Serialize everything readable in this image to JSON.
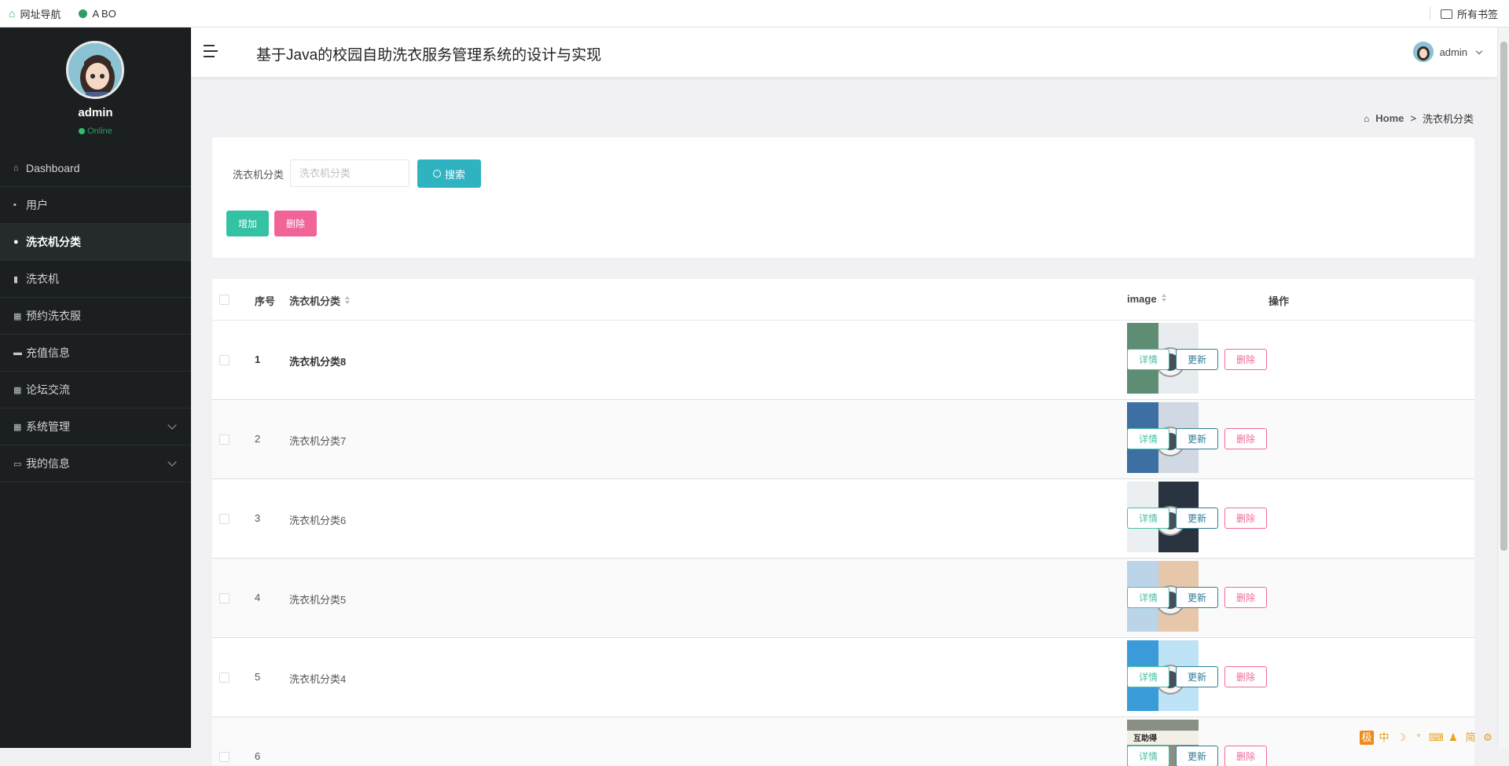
{
  "bookmarks": {
    "items": [
      {
        "icon": "house-icon",
        "label": "网址导航"
      },
      {
        "icon": "leaf-icon",
        "label": "A BO"
      }
    ],
    "all_label": "所有书签"
  },
  "sidebar": {
    "user": {
      "name": "admin",
      "status": "Online"
    },
    "items": [
      {
        "icon": "home-icon",
        "label": "Dashboard"
      },
      {
        "icon": "user-icon",
        "label": "用户"
      },
      {
        "icon": "pin-icon",
        "label": "洗衣机分类",
        "active": true
      },
      {
        "icon": "chart-icon",
        "label": "洗衣机"
      },
      {
        "icon": "grid-icon",
        "label": "预约洗衣服"
      },
      {
        "icon": "lock-icon",
        "label": "充值信息"
      },
      {
        "icon": "grid-icon",
        "label": "论坛交流"
      },
      {
        "icon": "grid-icon",
        "label": "系统管理",
        "expandable": true
      },
      {
        "icon": "card-icon",
        "label": "我的信息",
        "expandable": true
      }
    ]
  },
  "header": {
    "title": "基于Java的校园自助洗衣服务管理系统的设计与实现",
    "user": "admin"
  },
  "breadcrumb": {
    "home": "Home",
    "separator": ">",
    "current": "洗衣机分类"
  },
  "search": {
    "label": "洗衣机分类",
    "placeholder": "洗衣机分类",
    "button": "搜索"
  },
  "actions": {
    "add": "增加",
    "delete": "删除"
  },
  "table": {
    "headers": {
      "index": "序号",
      "category": "洗衣机分类",
      "image": "image",
      "ops": "操作"
    },
    "row_actions": {
      "detail": "详情",
      "update": "更新",
      "delete": "删除"
    },
    "rows": [
      {
        "index": "1",
        "category": "洗衣机分类8",
        "image_colors": [
          "#5f8d74",
          "#e9ecef"
        ]
      },
      {
        "index": "2",
        "category": "洗衣机分类7",
        "image_colors": [
          "#3d6fa3",
          "#cfd8e3"
        ]
      },
      {
        "index": "3",
        "category": "洗衣机分类6",
        "image_colors": [
          "#eceff2",
          "#2a3440"
        ]
      },
      {
        "index": "4",
        "category": "洗衣机分类5",
        "image_colors": [
          "#bcd4e8",
          "#e7c7a9"
        ]
      },
      {
        "index": "5",
        "category": "洗衣机分类4",
        "image_colors": [
          "#3a9bd8",
          "#bfe3f6"
        ]
      },
      {
        "index": "6",
        "category": "",
        "image_colors": [
          "#8a8f86",
          "#f2efe6"
        ]
      }
    ],
    "partial_image_text": "互助得"
  },
  "tray": [
    "极",
    "中",
    "☽",
    "°",
    "⌨",
    "♟",
    "简",
    "⚙"
  ]
}
